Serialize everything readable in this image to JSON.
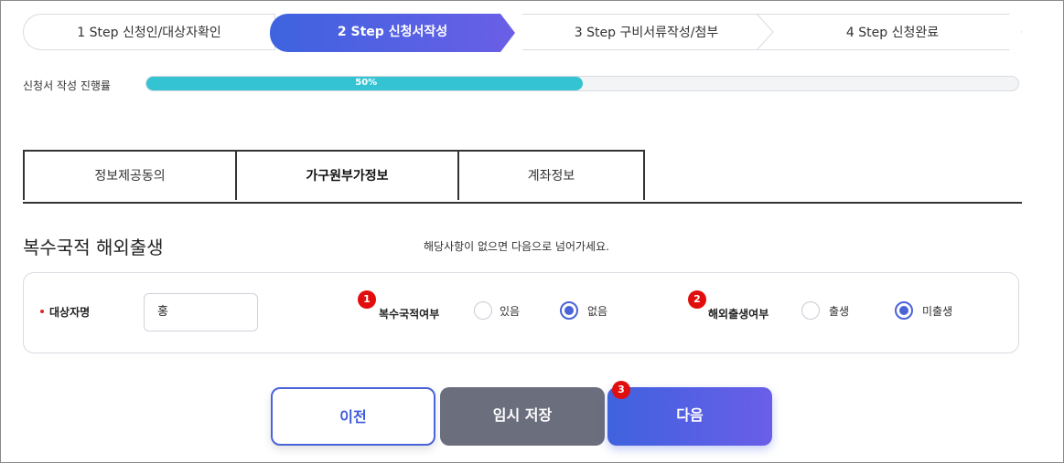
{
  "steps": [
    {
      "label": "1 Step 신청인/대상자확인",
      "active": false
    },
    {
      "label": "2 Step 신청서작성",
      "active": true
    },
    {
      "label": "3 Step 구비서류작성/첨부",
      "active": false
    },
    {
      "label": "4 Step 신청완료",
      "active": false
    }
  ],
  "progress": {
    "label": "신청서 작성 진행률",
    "value_percent": 50,
    "text": "50%"
  },
  "tabs": [
    {
      "label": "정보제공동의",
      "active": false
    },
    {
      "label": "가구원부가정보",
      "active": true
    },
    {
      "label": "계좌정보",
      "active": false
    }
  ],
  "section": {
    "title": "복수국적 해외출생",
    "notice": "해당사항이 없으면 다음으로 넘어가세요."
  },
  "form": {
    "name_label": "대상자명",
    "name_value": "홍",
    "dual_nationality": {
      "badge": "1",
      "label": "복수국적여부",
      "options": [
        "있음",
        "없음"
      ],
      "selected": "없음"
    },
    "overseas_birth": {
      "badge": "2",
      "label": "해외출생여부",
      "options": [
        "출생",
        "미출생"
      ],
      "selected": "미출생"
    }
  },
  "buttons": {
    "prev": "이전",
    "temp_save": "임시 저장",
    "next": "다음",
    "next_badge": "3"
  },
  "colors": {
    "accent": "#4a63d8",
    "progress": "#33c3d3",
    "badge": "#e10e0e",
    "save_button": "#6b6e7d"
  }
}
